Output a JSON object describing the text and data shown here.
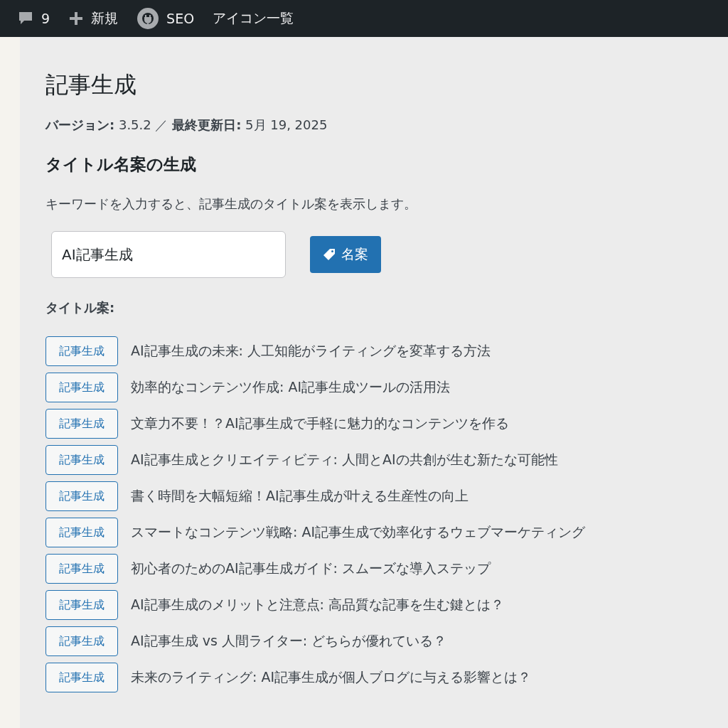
{
  "admin_bar": {
    "comments": "9",
    "new": "新規",
    "seo": "SEO",
    "icons": "アイコン一覧"
  },
  "page": {
    "title": "記事生成",
    "version": "**バージョン:** 3.5.2 ／ **最終更新日:** 5月 19, 2025",
    "section_title": "タイトル名案の生成",
    "description": "キーワードを入力すると、記事生成のタイトル案を表示します。",
    "keyword": {
      "value": "AI記事生成"
    },
    "generate_button": "名案",
    "results_label": "タイトル案:",
    "titles": [
      {
        "button": "記事生成",
        "text": "AI記事生成の未来: 人工知能がライティングを変革する方法"
      },
      {
        "button": "記事生成",
        "text": "効率的なコンテンツ作成: AI記事生成ツールの活用法"
      },
      {
        "button": "記事生成",
        "text": "文章力不要！？AI記事生成で手軽に魅力的なコンテンツを作る"
      },
      {
        "button": "記事生成",
        "text": "AI記事生成とクリエイティビティ: 人間とAIの共創が生む新たな可能性"
      },
      {
        "button": "記事生成",
        "text": "書く時間を大幅短縮！AI記事生成が叶える生産性の向上"
      },
      {
        "button": "記事生成",
        "text": "スマートなコンテンツ戦略: AI記事生成で効率化するウェブマーケティング"
      },
      {
        "button": "記事生成",
        "text": "初心者のためのAI記事生成ガイド: スムーズな導入ステップ"
      },
      {
        "button": "記事生成",
        "text": "AI記事生成のメリットと注意点: 高品質な記事を生む鍵とは？"
      },
      {
        "button": "記事生成",
        "text": "AI記事生成 vs 人間ライター: どちらが優れている？"
      },
      {
        "button": "記事生成",
        "text": "未来のライティング: AI記事生成が個人ブログに与える影響とは？"
      }
    ]
  }
}
